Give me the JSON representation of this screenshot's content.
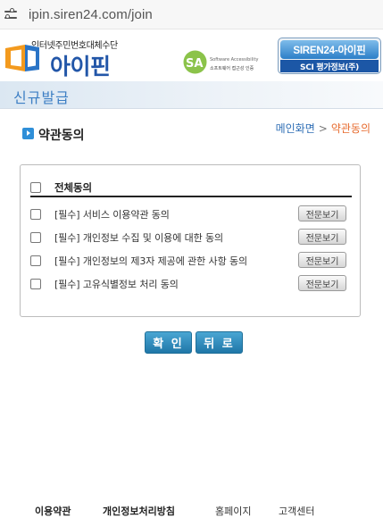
{
  "browser": {
    "url": "ipin.siren24.com/join"
  },
  "header": {
    "logo_tagline": "인터넷주민번호대체수단",
    "logo_name": "아이핀",
    "sa_text1": "Software Accessibility",
    "sa_text2": "소프트웨어 접근성 인증",
    "siren_top": "SIREN24-아이핀",
    "siren_bottom": "SCI 평가정보(주)"
  },
  "title": "신규발급",
  "section": {
    "title": "약관동의",
    "breadcrumb": {
      "home": "메인화면",
      "separator": ">",
      "current": "약관동의"
    }
  },
  "agreements": {
    "all_label": "전체동의",
    "items": [
      {
        "label": "[필수] 서비스 이용약관 동의",
        "view": "전문보기"
      },
      {
        "label": "[필수] 개인정보 수집 및 이용에 대한 동의",
        "view": "전문보기"
      },
      {
        "label": "[필수] 개인정보의 제3자 제공에 관한 사항 동의",
        "view": "전문보기"
      },
      {
        "label": "[필수] 고유식별정보 처리 동의",
        "view": "전문보기"
      }
    ]
  },
  "buttons": {
    "confirm": "확 인",
    "back": "뒤 로"
  },
  "footer": {
    "terms": "이용약관",
    "privacy": "개인정보처리방침",
    "homepage": "홈페이지",
    "support": "고객센터"
  },
  "colors": {
    "accent": "#2f8fd8",
    "button": "#1f77a8",
    "breadcrumb_current": "#e76a2d"
  }
}
